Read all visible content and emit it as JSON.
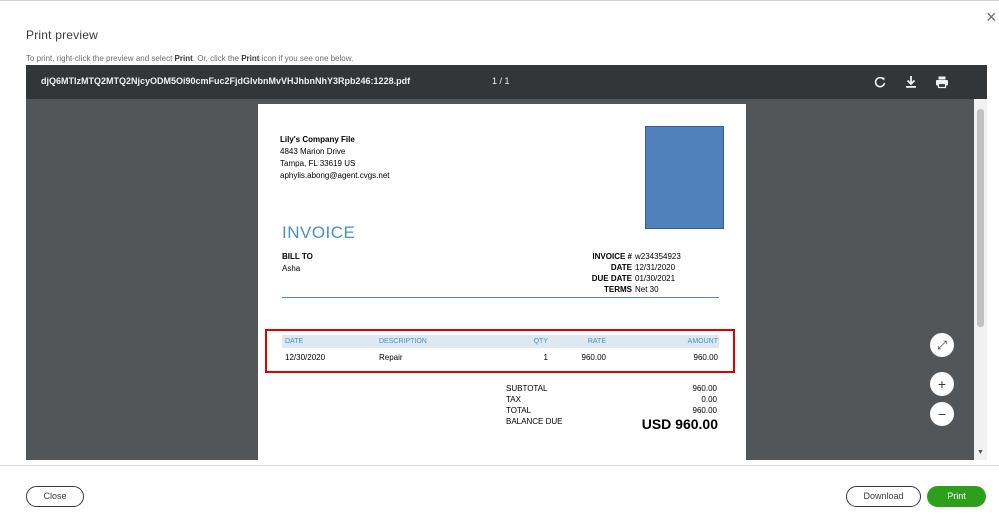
{
  "dialog": {
    "title": "Print preview",
    "close_glyph": "×",
    "hint_pre": "To print, right-click the preview and select ",
    "hint_b1": "Print",
    "hint_mid": ". Or, click the ",
    "hint_b2": "Print",
    "hint_post": " icon if you see one below."
  },
  "viewer": {
    "filename": "djQ6MTIzMTQ2MTQ2NjcyODM5Oi90cmFuc2FjdGlvbnMvVHJhbnNhY3Rpb246:1228.pdf",
    "page_indicator": "1 / 1",
    "icons": [
      "rotate-icon",
      "download-icon",
      "printer-icon"
    ]
  },
  "invoice": {
    "company_name": "Lily's Company File",
    "address_line1": "4843  Marion Drive",
    "address_line2": "Tampa, FL  33619 US",
    "email": "aphylis.abong@agent.cvgs.net",
    "heading": "INVOICE",
    "bill_to_label": "BILL TO",
    "bill_to_name": "Asha",
    "meta": [
      {
        "label": "INVOICE #",
        "value": "w234354923"
      },
      {
        "label": "DATE",
        "value": "12/31/2020"
      },
      {
        "label": "DUE DATE",
        "value": "01/30/2021"
      },
      {
        "label": "TERMS",
        "value": "Net 30"
      }
    ],
    "columns": {
      "date": "DATE",
      "description": "DESCRIPTION",
      "qty": "QTY",
      "rate": "RATE",
      "amount": "AMOUNT"
    },
    "rows": [
      {
        "date": "12/30/2020",
        "description": "Repair",
        "qty": "1",
        "rate": "960.00",
        "amount": "960.00"
      }
    ],
    "totals": [
      {
        "label": "SUBTOTAL",
        "value": "960.00"
      },
      {
        "label": "TAX",
        "value": "0.00"
      },
      {
        "label": "TOTAL",
        "value": "960.00"
      },
      {
        "label": "BALANCE DUE",
        "value": ""
      }
    ],
    "balance_due_display": "USD 960.00"
  },
  "zoom_controls": {
    "fit": "⤢",
    "zoom_in": "+",
    "zoom_out": "−"
  },
  "footer": {
    "close_label": "Close",
    "download_label": "Download",
    "print_label": "Print"
  },
  "colors": {
    "accent_green": "#2ca01c",
    "viewer_bg": "#525659",
    "toolbar_bg": "#323639",
    "invoice_blue": "#4a8fc7",
    "highlight_red": "#e00000"
  }
}
